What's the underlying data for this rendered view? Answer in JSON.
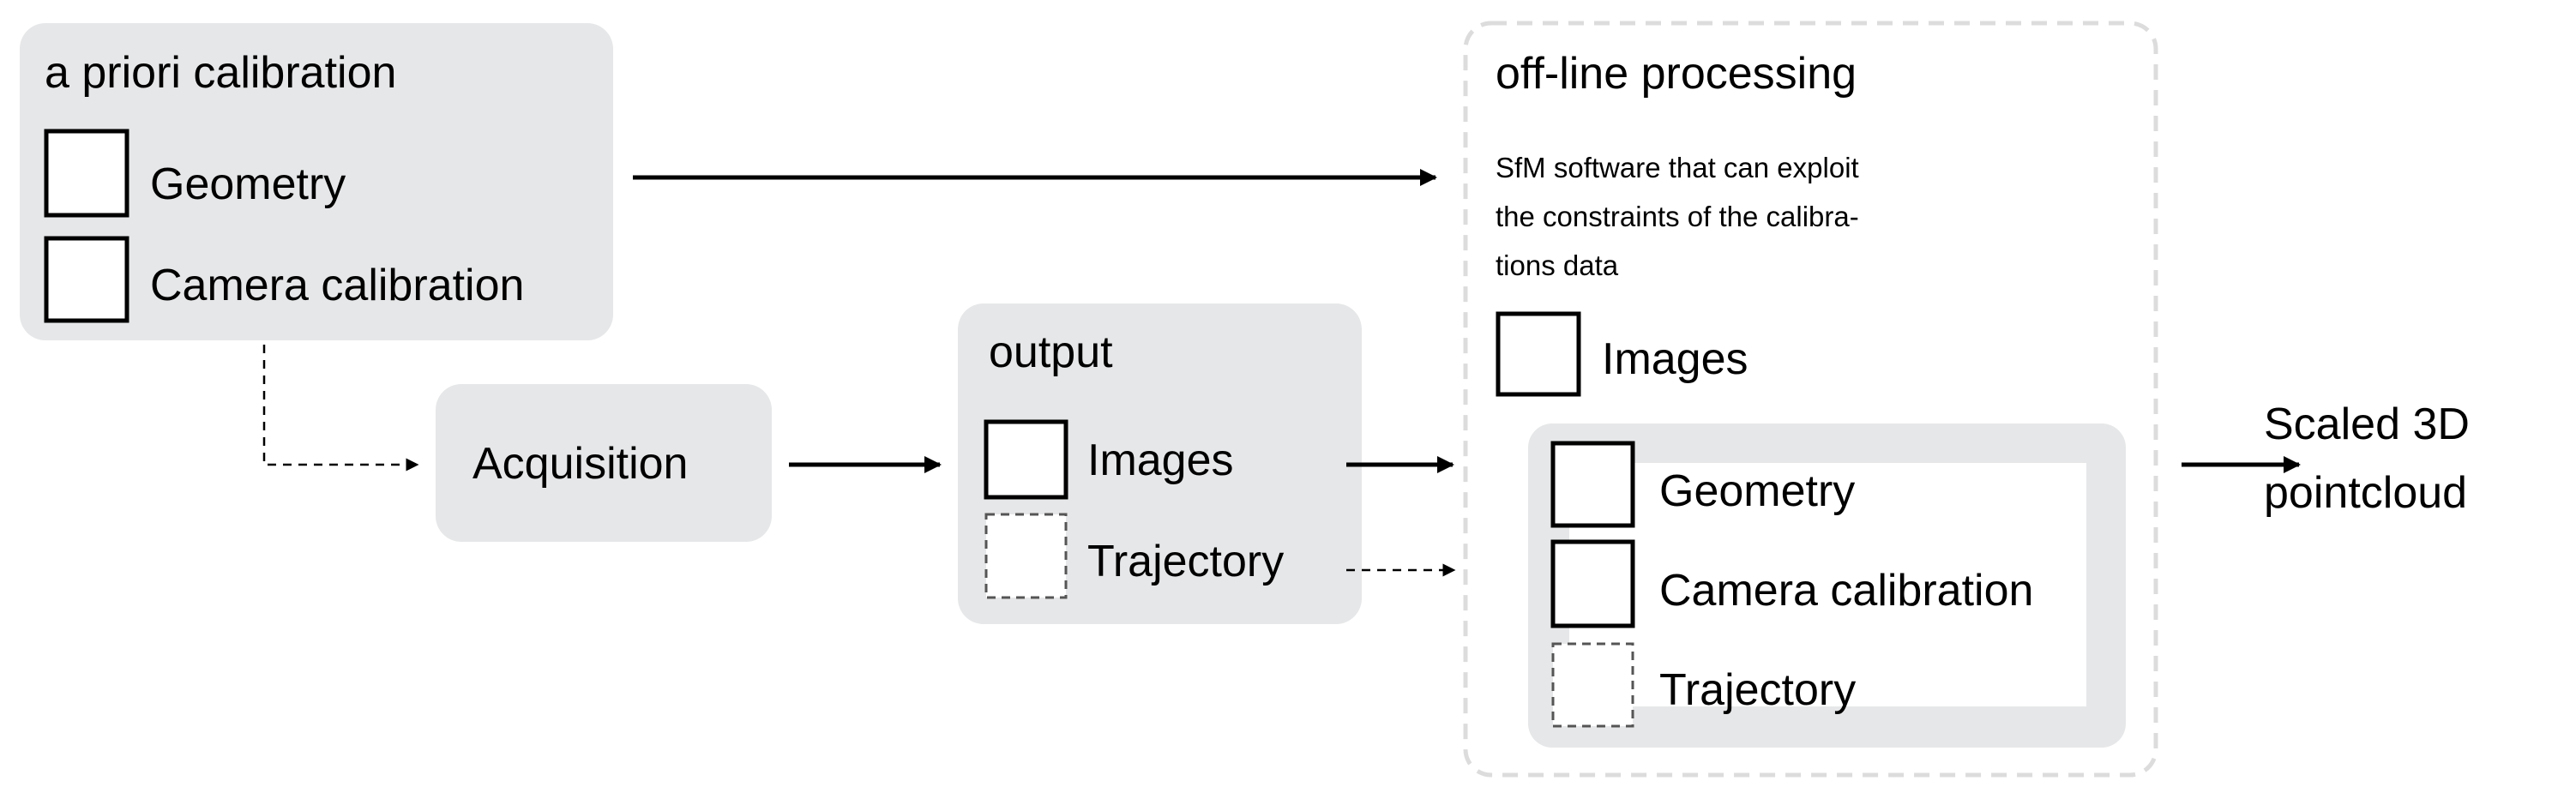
{
  "apriori": {
    "title": "a priori calibration",
    "items": [
      "Geometry",
      "Camera calibration"
    ]
  },
  "acquisition": {
    "label": "Acquisition"
  },
  "output": {
    "title": "output",
    "items": [
      "Images",
      "Trajectory"
    ]
  },
  "offline": {
    "title": "off-line processing",
    "description": [
      "SfM software that can exploit",
      "the constraints of the calibra-",
      "tions data"
    ],
    "images": "Images",
    "inner_items": [
      "Geometry",
      "Camera calibration",
      "Trajectory"
    ]
  },
  "result": {
    "lines": [
      "Scaled 3D",
      "pointcloud"
    ]
  }
}
